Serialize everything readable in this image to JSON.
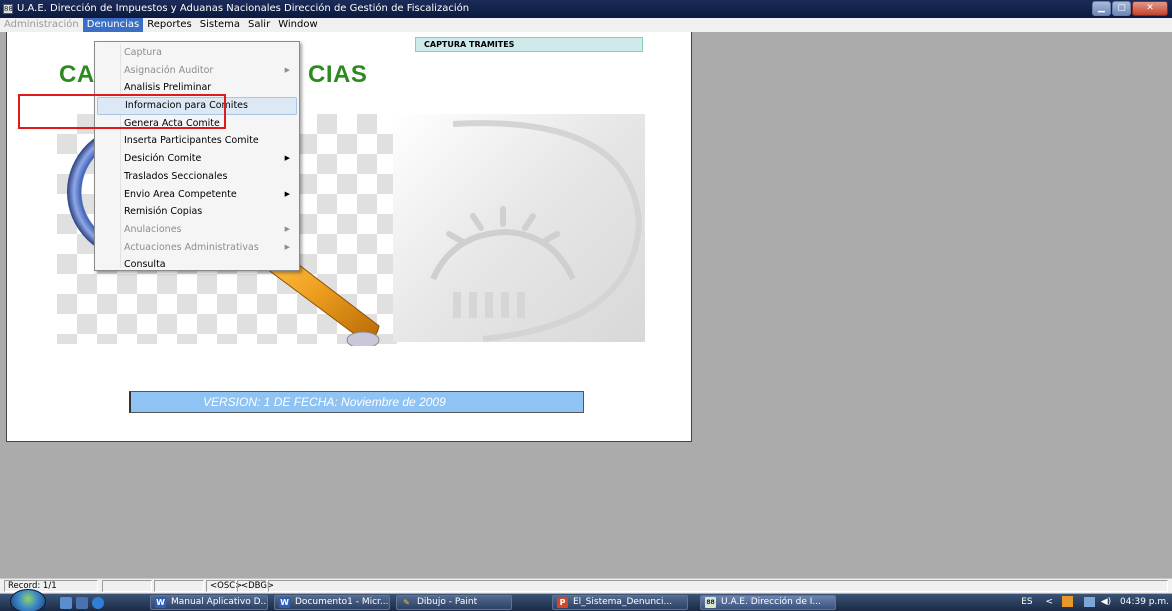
{
  "window": {
    "title": "U.A.E. Dirección de Impuestos y Aduanas Nacionales  Dirección de Gestión de Fiscalización",
    "icon_text": "88"
  },
  "menubar": {
    "items": [
      {
        "label": "Administración",
        "state": "disabled"
      },
      {
        "label": "Denuncias",
        "state": "active"
      },
      {
        "label": "Reportes",
        "state": "normal"
      },
      {
        "label": "Sistema",
        "state": "normal"
      },
      {
        "label": "Salir",
        "state": "normal"
      },
      {
        "label": "Window",
        "state": "normal"
      }
    ]
  },
  "dropdown": {
    "items": [
      {
        "label": "Captura",
        "disabled": true,
        "submenu": false
      },
      {
        "label": "Asignación Auditor",
        "disabled": true,
        "submenu": true
      },
      {
        "label": "Analisis Preliminar",
        "disabled": false,
        "submenu": false
      },
      {
        "label": "Informacion para Comites",
        "disabled": false,
        "submenu": false,
        "hover": true
      },
      {
        "label": "Genera Acta Comite",
        "disabled": false,
        "submenu": false
      },
      {
        "label": "Inserta Participantes Comite",
        "disabled": false,
        "submenu": false
      },
      {
        "label": "Desición  Comite",
        "disabled": false,
        "submenu": true
      },
      {
        "label": "Traslados Seccionales",
        "disabled": false,
        "submenu": false
      },
      {
        "label": "Envio Area Competente",
        "disabled": false,
        "submenu": true
      },
      {
        "label": "Remisión  Copias",
        "disabled": false,
        "submenu": false
      },
      {
        "label": "Anulaciones",
        "disabled": true,
        "submenu": true
      },
      {
        "label": "Actuaciones Administrativas",
        "disabled": true,
        "submenu": true
      },
      {
        "label": "Consulta",
        "disabled": false,
        "submenu": false
      }
    ]
  },
  "form": {
    "title_left": "CA",
    "title_right": "CIAS",
    "captura_label": "CAPTURA TRAMITES",
    "version_text": "VERSION:  1 DE FECHA:  Noviembre de 2009",
    "accent_green": "#2c8a1f",
    "version_bg": "#8ec3f3"
  },
  "statusbar": {
    "record": "Record: 1/1",
    "osc": "<OSC>",
    "dbg": "<DBG>"
  },
  "taskbar": {
    "buttons": [
      {
        "label": "Manual Aplicativo D...",
        "icon": "word-icon",
        "icon_text": "W",
        "icon_color": "#2b5fb8"
      },
      {
        "label": "Documento1 - Micr...",
        "icon": "word-icon",
        "icon_text": "W",
        "icon_color": "#2b5fb8"
      },
      {
        "label": "Dibujo - Paint",
        "icon": "paint-icon",
        "icon_text": "✎",
        "icon_color": "#d9a520"
      },
      {
        "label": "El_Sistema_Denunci...",
        "icon": "powerpoint-icon",
        "icon_text": "P",
        "icon_color": "#d24726"
      },
      {
        "label": "U.A.E. Dirección de I...",
        "icon": "app-icon",
        "icon_text": "88",
        "icon_color": "#d7e6cf",
        "active": true
      }
    ],
    "tray": {
      "lang": "ES",
      "time": "04:39 p.m."
    }
  }
}
